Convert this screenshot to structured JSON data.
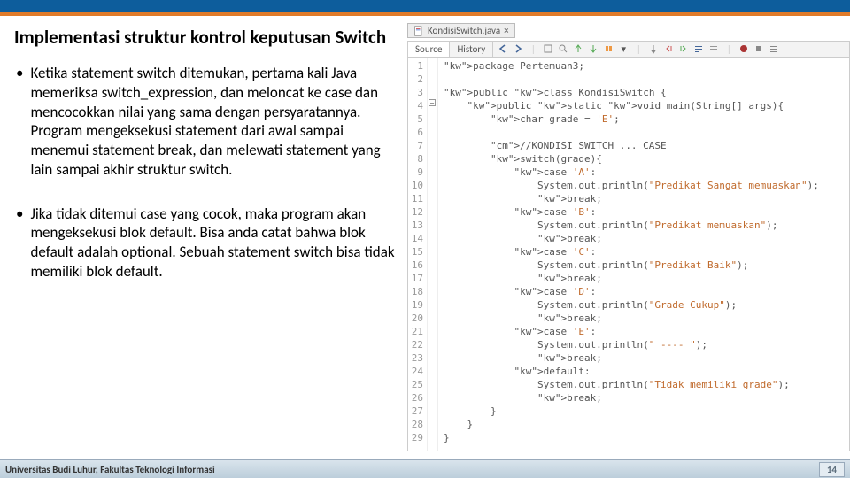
{
  "slide": {
    "title": "Implementasi struktur kontrol keputusan Switch",
    "bullet1": "Ketika statement switch ditemukan, pertama kali Java memeriksa switch_expression, dan meloncat ke case dan mencocokkan nilai yang sama dengan persyaratannya. Program mengeksekusi statement dari awal sampai menemui statement break, dan melewati statement yang lain sampai akhir struktur switch.",
    "bullet2": "Jika tidak ditemui case yang cocok, maka program akan mengeksekusi blok default. Bisa anda catat bahwa blok default adalah optional. Sebuah statement switch bisa tidak memiliki blok default."
  },
  "editor": {
    "filename": "KondisiSwitch.java",
    "close_x": "×",
    "tabs": {
      "source": "Source",
      "history": "History"
    },
    "lines": [
      "1",
      "2",
      "3",
      "4",
      "5",
      "6",
      "7",
      "8",
      "9",
      "10",
      "11",
      "12",
      "13",
      "14",
      "15",
      "16",
      "17",
      "18",
      "19",
      "20",
      "21",
      "22",
      "23",
      "24",
      "25",
      "26",
      "27",
      "28",
      "29"
    ],
    "code": "package Pertemuan3;\n\npublic class KondisiSwitch {\n    public static void main(String[] args){\n        char grade = 'E';\n\n        //KONDISI SWITCH ... CASE\n        switch(grade){\n            case 'A':\n                System.out.println(\"Predikat Sangat memuaskan\");\n                break;\n            case 'B':\n                System.out.println(\"Predikat memuaskan\");\n                break;\n            case 'C':\n                System.out.println(\"Predikat Baik\");\n                break;\n            case 'D':\n                System.out.println(\"Grade Cukup\");\n                break;\n            case 'E':\n                System.out.println(\" ---- \");\n                break;\n            default:\n                System.out.println(\"Tidak memiliki grade\");\n                break;\n        }\n    }\n}"
  },
  "footer": {
    "university": "Universitas Budi Luhur, Fakultas Teknologi Informasi",
    "page": "14"
  }
}
